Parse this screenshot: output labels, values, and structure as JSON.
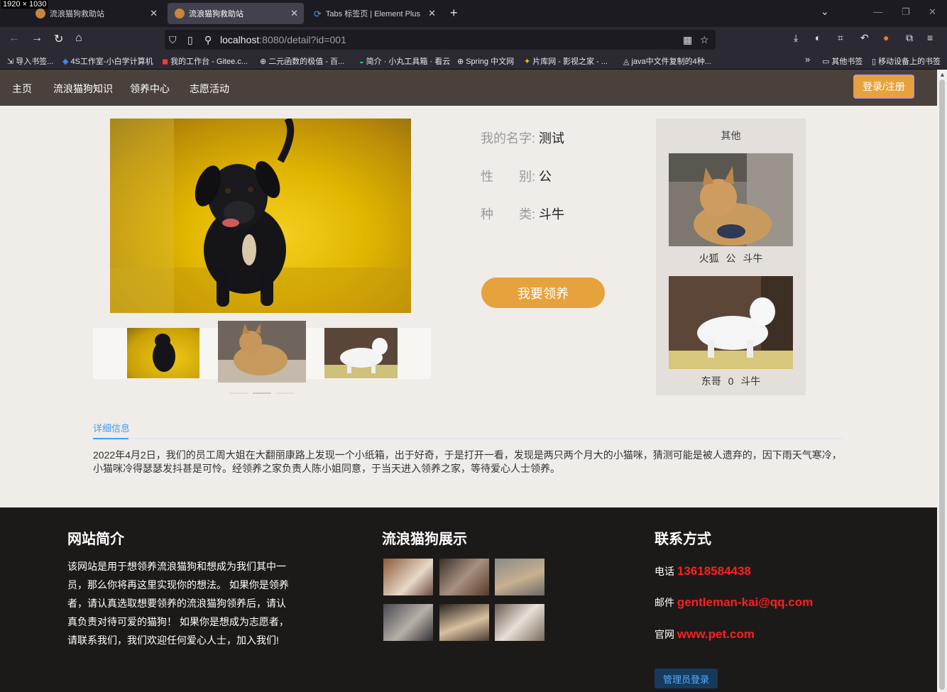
{
  "screen": {
    "resolution_label": "1920 × 1030"
  },
  "browser": {
    "tabs": [
      {
        "label": "流浪猫狗救助站",
        "active": false
      },
      {
        "label": "流浪猫狗救助站",
        "active": true
      },
      {
        "label": "Tabs 标签页 | Element Plus",
        "active": false
      }
    ],
    "url_host": "localhost",
    "url_rest": ":8080/detail?id=001",
    "bookmarks": [
      "导入书签...",
      "4S工作室-小白学计算机",
      "我的工作台 - Gitee.c...",
      "二元函数的极值 - 百...",
      "简介 · 小丸工具箱 · 看云",
      "Spring 中文网",
      "片库网 - 影视之家 - ...",
      "java中文件复制的4种...",
      "其他书签",
      "移动设备上的书签"
    ]
  },
  "nav": {
    "items": [
      "主页",
      "流浪猫狗知识",
      "领养中心",
      "志愿活动"
    ],
    "login_label": "登录/注册"
  },
  "pet": {
    "name_label": "我的名字:",
    "name_value": "测试",
    "gender_label": "性　　别:",
    "gender_value": "公",
    "breed_label": "种　　类:",
    "breed_value": "斗牛",
    "adopt_label": "我要领养"
  },
  "others": {
    "title": "其他",
    "items": [
      {
        "name": "火狐",
        "gender": "公",
        "breed": "斗牛"
      },
      {
        "name": "东哥",
        "gender": "0",
        "breed": "斗牛"
      }
    ]
  },
  "detail": {
    "tab_label": "详细信息",
    "text": "2022年4月2日，我们的员工周大姐在大翻丽康路上发现一个小纸箱，出于好奇，于是打开一看，发现是两只两个月大的小猫咪，猜测可能是被人遗弃的，因下雨天气寒冷，小猫咪冷得瑟瑟发抖甚是可怜。经领养之家负责人陈小姐同意，于当天进入领养之家，等待爱心人士领养。"
  },
  "footer": {
    "intro_title": "网站简介",
    "intro_text": "该网站是用于想领养流浪猫狗和想成为我们其中一员，那么你将再这里实现你的想法。 如果你是领养者，请认真选取想要领养的流浪猫狗领养后，请认真负责对待可爱的猫狗！ 如果你是想成为志愿者，请联系我们，我们欢迎任何爱心人士，加入我们!",
    "gallery_title": "流浪猫狗展示",
    "contact_title": "联系方式",
    "phone_label": "电话",
    "phone_value": "13618584438",
    "email_label": "邮件",
    "email_value": "gentleman-kai@qq.com",
    "site_label": "官网",
    "site_value": "www.pet.com",
    "admin_label": "管理员登录"
  },
  "colors": {
    "accent": "#e6a23c",
    "nav_bg": "#4a413c",
    "footer_bg": "#1c1a19",
    "link_red": "#ff1f1f",
    "tab_blue": "#409eff"
  }
}
